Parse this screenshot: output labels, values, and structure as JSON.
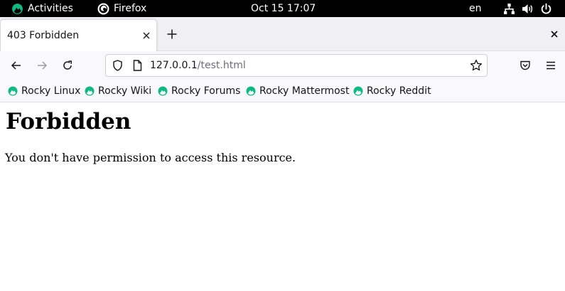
{
  "topbar": {
    "activities": "Activities",
    "app_name": "Firefox",
    "clock": "Oct 15  17:07",
    "language": "en"
  },
  "tabs": [
    {
      "title": "403 Forbidden",
      "active": true
    }
  ],
  "urlbar": {
    "host": "127.0.0.1",
    "path": "/test.html"
  },
  "bookmarks": [
    {
      "label": "Rocky Linux"
    },
    {
      "label": "Rocky Wiki"
    },
    {
      "label": "Rocky Forums"
    },
    {
      "label": "Rocky Mattermost"
    },
    {
      "label": "Rocky Reddit"
    }
  ],
  "page": {
    "heading": "Forbidden",
    "message": "You don't have permission to access this resource."
  },
  "colors": {
    "rocky_green": "#10b981",
    "topbar_bg": "#000000",
    "tabstrip_bg": "#f0f0f4",
    "toolbar_bg": "#f9f9fb"
  },
  "icons": {
    "activities": "rocky-logo-icon",
    "app": "firefox-icon",
    "tray": [
      "network-icon",
      "volume-icon",
      "power-icon"
    ]
  }
}
